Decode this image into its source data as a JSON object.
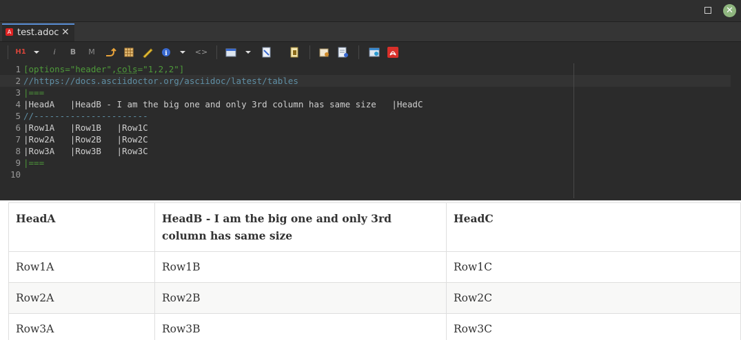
{
  "window": {
    "close_symbol": "✕"
  },
  "tab": {
    "title": "test.adoc",
    "close_symbol": "✕",
    "icon": "asciidoc-file-icon"
  },
  "toolbar": {
    "items": [
      "heading-icon",
      "dropdown-icon",
      "italic-icon",
      "bold-icon",
      "monospace-icon",
      "link-icon",
      "table-icon",
      "pencil-icon",
      "info-icon",
      "dropdown-icon",
      "code-icon",
      "window-icon",
      "dropdown-icon",
      "document-icon",
      "document-export-icon",
      "folder-icon",
      "settings-icon",
      "browser-icon",
      "pdf-icon"
    ],
    "h1_label": "H1",
    "italic_label": "i",
    "bold_label": "B",
    "mono_label": "M",
    "code_label": "<>"
  },
  "editor": {
    "lines": [
      {
        "n": "1",
        "parts": [
          [
            "[options=\"header\",",
            "green"
          ],
          [
            "cols",
            "green-u"
          ],
          [
            "=\"1,2,2\"]",
            "green"
          ]
        ]
      },
      {
        "n": "2",
        "parts": [
          [
            "//https://docs.asciidoctor.org/asciidoc/latest/tables",
            "comment"
          ]
        ]
      },
      {
        "n": "3",
        "parts": [
          [
            "|===",
            "green"
          ]
        ]
      },
      {
        "n": "4",
        "parts": [
          [
            "|HeadA   |HeadB - I am the big one and only 3rd column has same size   |HeadC",
            "plain"
          ]
        ]
      },
      {
        "n": "5",
        "parts": [
          [
            "//----------------------",
            "comment"
          ]
        ]
      },
      {
        "n": "6",
        "parts": [
          [
            "|Row1A   |Row1B   |Row1C",
            "plain"
          ]
        ]
      },
      {
        "n": "7",
        "parts": [
          [
            "|Row2A   |Row2B   |Row2C",
            "plain"
          ]
        ]
      },
      {
        "n": "8",
        "parts": [
          [
            "|Row3A   |Row3B   |Row3C",
            "plain"
          ]
        ]
      },
      {
        "n": "9",
        "parts": [
          [
            "|===",
            "green"
          ]
        ]
      },
      {
        "n": "10",
        "parts": []
      }
    ]
  },
  "preview": {
    "headers": [
      "HeadA",
      "HeadB - I am the big one and only 3rd column has same size",
      "HeadC"
    ],
    "rows": [
      [
        "Row1A",
        "Row1B",
        "Row1C"
      ],
      [
        "Row2A",
        "Row2B",
        "Row2C"
      ],
      [
        "Row3A",
        "Row3B",
        "Row3C"
      ]
    ]
  },
  "colors": {
    "accent": "#5a8fd6",
    "code_green": "#4e9a3a",
    "comment": "#5f8fa5"
  }
}
